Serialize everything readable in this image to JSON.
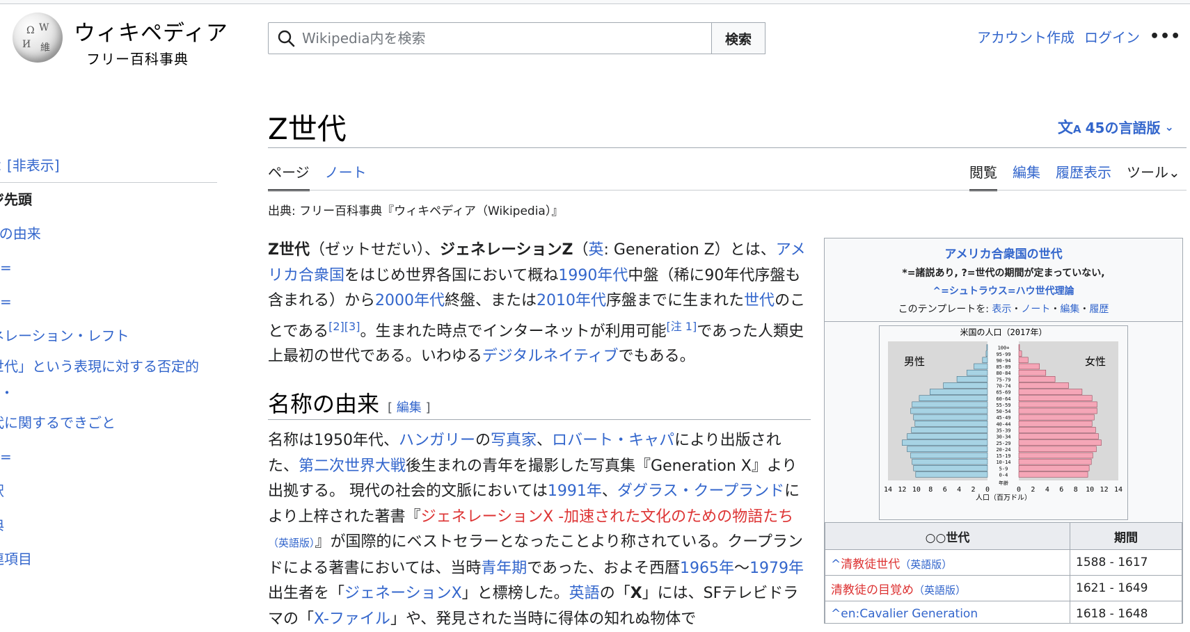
{
  "header": {
    "logo_alt": "Wikipedia globe",
    "wordmark_title": "ウィキペディア",
    "wordmark_tagline": "フリー百科事典",
    "search_placeholder": "Wikipedia内を検索",
    "search_button": "検索",
    "create_account": "アカウント作成",
    "login": "ログイン",
    "more": "•••"
  },
  "toc": {
    "hide_label": "[非表示]",
    "items": [
      "ページ先頭",
      "名称の由来",
      "定義",
      "特徴",
      "ジェネレーション・レフト",
      "「Z世代」という表現に対する否定的見解",
      "Z世代に関するできごと",
      "脚注",
      "注釈",
      "出典",
      "関連項目"
    ],
    "visible_texts": [
      "ジ先頭",
      "5の由来",
      "",
      "",
      "ネレーション・レフト",
      "世代」という表現に対する否定的",
      "",
      "代に関するできごと",
      "",
      "釈",
      "典",
      "連項目"
    ]
  },
  "article": {
    "title": "Z世代",
    "languages": "45の言語版",
    "tabs_left": [
      "ページ",
      "ノート"
    ],
    "tabs_right": [
      "閲覧",
      "編集",
      "履歴表示",
      "ツール"
    ],
    "source_line": "出典: フリー百科事典『ウィキペディア（Wikipedia）』",
    "section_heading": "名称の由来",
    "section_edit": "編集"
  },
  "navbox": {
    "title": "アメリカ合衆国の世代",
    "note1": "*=諸説あり, ?=世代の期間が定まっていない,",
    "note2": "^=シュトラウス=ハウ世代理論",
    "template_prefix": "このテンプレートを: ",
    "template_links": [
      "表示",
      "ノート",
      "編集",
      "履歴"
    ],
    "pyramid_caption": "米国の人口（2017年）",
    "male_label": "男性",
    "female_label": "女性",
    "age_axis_label": "年齢",
    "x_axis_label": "人口（百万ドル）",
    "table_header_gen": "○○世代",
    "table_header_period": "期間",
    "rows": [
      {
        "name_prefix": "^",
        "name": "清教徒世代",
        "lang": "（英語版）",
        "period": "1588 - 1617",
        "red": true
      },
      {
        "name_prefix": "",
        "name": "清教徒の目覚め",
        "lang": "（英語版）",
        "period": "1621 - 1649",
        "red": true
      },
      {
        "name_prefix": "^",
        "name": "en:Cavalier Generation",
        "lang": "",
        "period": "1618 - 1648",
        "red": false
      }
    ]
  },
  "chart_data": {
    "type": "bar",
    "title": "米国の人口（2017年）",
    "xlabel": "人口（百万ドル）",
    "ylabel": "年齢",
    "xlim": [
      0,
      14
    ],
    "x_ticks": [
      14,
      12,
      10,
      8,
      6,
      4,
      2,
      0,
      0,
      2,
      4,
      6,
      8,
      10,
      12,
      14
    ],
    "categories": [
      "0-4",
      "5-9",
      "10-14",
      "15-19",
      "20-24",
      "25-29",
      "30-34",
      "35-39",
      "40-44",
      "45-49",
      "50-54",
      "55-59",
      "60-64",
      "65-69",
      "70-74",
      "75-79",
      "80-84",
      "85-89",
      "90-94",
      "95-99",
      "100+"
    ],
    "series": [
      {
        "name": "男性",
        "values": [
          10.1,
          10.4,
          10.6,
          10.8,
          11.3,
          12.0,
          11.3,
          10.7,
          10.2,
          10.4,
          10.8,
          10.6,
          9.6,
          8.1,
          6.2,
          4.3,
          2.9,
          1.9,
          0.7,
          0.2,
          0.1
        ]
      },
      {
        "name": "女性",
        "values": [
          9.7,
          9.9,
          10.2,
          10.4,
          10.9,
          11.6,
          11.2,
          10.8,
          10.3,
          10.6,
          11.0,
          11.0,
          10.3,
          8.9,
          7.0,
          5.1,
          3.8,
          2.9,
          1.3,
          0.4,
          0.1
        ]
      }
    ]
  },
  "colors": {
    "link": "#3366cc",
    "redlink": "#dd3333",
    "male_bar": "#a7d3e4",
    "female_bar": "#f5a6b7"
  }
}
